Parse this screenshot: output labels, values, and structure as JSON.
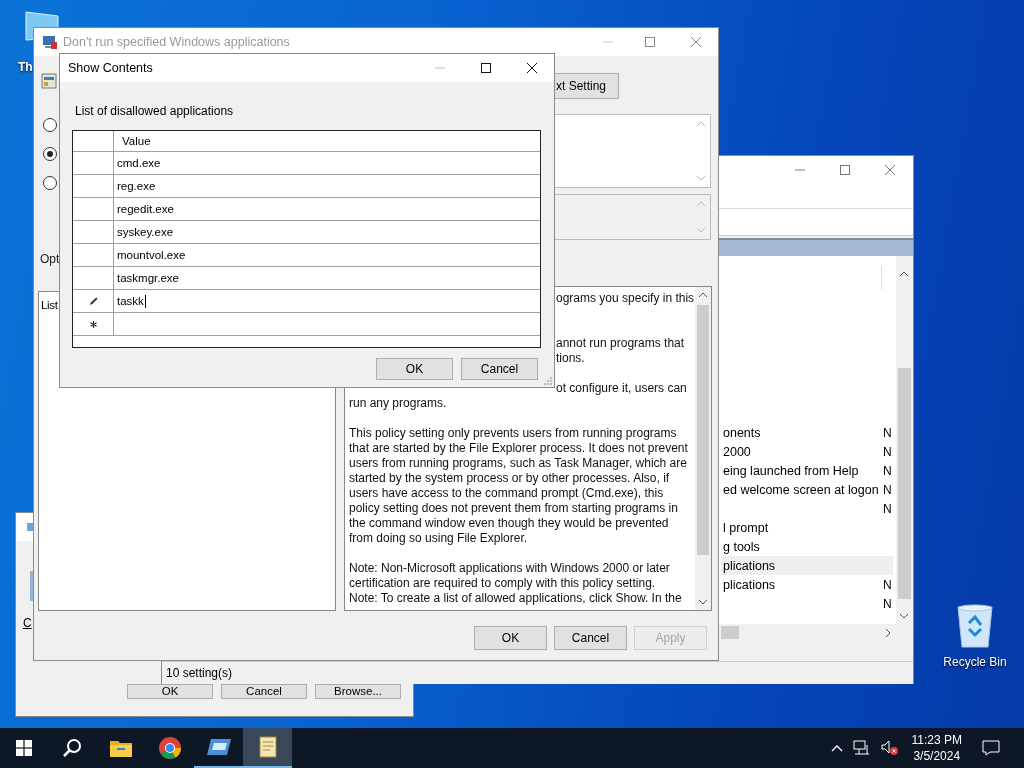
{
  "desktop_icons": [
    {
      "kind": "computer",
      "label": "Th"
    },
    {
      "kind": "recycle",
      "label": "Recycle Bin"
    }
  ],
  "run_dialog": {
    "access_key_label": "C",
    "buttons": [
      "OK",
      "Cancel",
      "Browse..."
    ]
  },
  "policy_editor": {
    "rows": [
      {
        "name": "onents",
        "state": "N",
        "selected": false
      },
      {
        "name": "2000",
        "state": "N",
        "selected": false
      },
      {
        "name": "eing launched from Help",
        "state": "N",
        "selected": false
      },
      {
        "name": "ed welcome screen at logon",
        "state": "N",
        "selected": false
      },
      {
        "state": "N",
        "selected": false
      },
      {
        "name": "l prompt",
        "selected": false
      },
      {
        "name": "g tools",
        "selected": false
      },
      {
        "name": "plications",
        "selected": true
      },
      {
        "name": "plications",
        "state": "N",
        "selected": false
      },
      {
        "state": "N",
        "selected": false
      }
    ],
    "status_bar": "10 setting(s)"
  },
  "policy_dialog": {
    "title": "Don't run specified Windows applications",
    "next_button": "xt Setting",
    "radios": [
      {
        "selected": false
      },
      {
        "selected": true
      },
      {
        "selected": false
      }
    ],
    "options_label": "Opt",
    "options_list_label": "List",
    "help": [
      [
        {
          "text": "ograms you specify in this",
          "cut": true
        }
      ],
      [
        {
          "text": "annot run programs that",
          "cut": true
        },
        {
          "text": "tions.",
          "cut": true
        }
      ],
      [
        {
          "text": "ot configure it, users can",
          "cut": true
        },
        {
          "text": "run any programs.",
          "cut": false
        }
      ],
      [
        {
          "text": "This policy setting only prevents users from running programs",
          "cut": false
        },
        {
          "text": "that are started by the File Explorer process. It does not prevent",
          "cut": false
        },
        {
          "text": "users from running programs, such as Task Manager, which are",
          "cut": false
        },
        {
          "text": "started by the system process or by other processes.  Also, if",
          "cut": false
        },
        {
          "text": "users have access to the command prompt (Cmd.exe), this",
          "cut": false
        },
        {
          "text": "policy setting does not prevent them from starting programs in",
          "cut": false
        },
        {
          "text": "the command window even though they would be prevented",
          "cut": false
        },
        {
          "text": "from doing so using File Explorer.",
          "cut": false
        }
      ],
      [
        {
          "text": "Note: Non-Microsoft applications with Windows 2000 or later",
          "cut": false
        },
        {
          "text": "certification are required to comply with this policy setting.",
          "cut": false
        },
        {
          "text": "Note: To create a list of allowed applications, click Show.  In the",
          "cut": false
        }
      ]
    ],
    "buttons": [
      {
        "label": "OK",
        "disabled": false
      },
      {
        "label": "Cancel",
        "disabled": false
      },
      {
        "label": "Apply",
        "disabled": true
      }
    ]
  },
  "show_contents": {
    "title": "Show Contents",
    "list_label": "List of disallowed applications",
    "column": "Value",
    "rows": [
      {
        "kind": "value",
        "value": "cmd.exe"
      },
      {
        "kind": "value",
        "value": "reg.exe"
      },
      {
        "kind": "value",
        "value": "regedit.exe"
      },
      {
        "kind": "value",
        "value": "syskey.exe"
      },
      {
        "kind": "value",
        "value": "mountvol.exe"
      },
      {
        "kind": "value",
        "value": "taskmgr.exe"
      },
      {
        "kind": "editing",
        "value": "taskk"
      },
      {
        "kind": "new"
      }
    ],
    "buttons": [
      "OK",
      "Cancel"
    ]
  },
  "taskbar": {
    "apps": [
      {
        "kind": "folder",
        "running": false,
        "active": false
      },
      {
        "kind": "browser",
        "running": false,
        "active": false
      },
      {
        "kind": "window",
        "running": true,
        "active": false
      },
      {
        "kind": "scroll",
        "running": true,
        "active": true
      }
    ],
    "time": "11:23 PM",
    "date": "3/5/2024"
  }
}
